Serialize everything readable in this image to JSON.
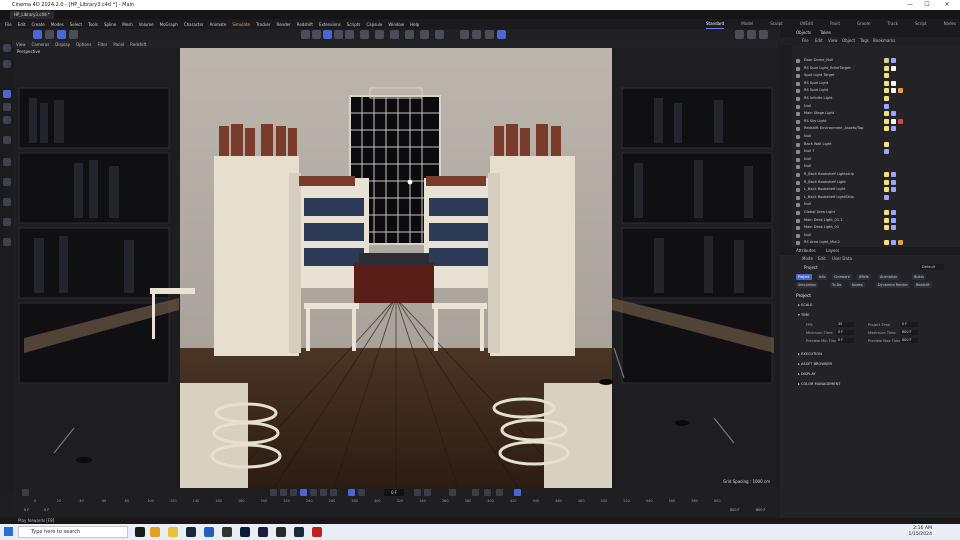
{
  "window": {
    "title": "Cinema 4D 2024.2.0 - [HP_Library3.c4d *] - Main",
    "controls": [
      "—",
      "☐",
      "✕"
    ]
  },
  "doc_tab": "HP_Library3.c4d *",
  "menus": [
    "File",
    "Edit",
    "Create",
    "Modes",
    "Select",
    "Tools",
    "Spline",
    "Mesh",
    "Volume",
    "MoGraph",
    "Character",
    "Animate",
    "Simulate",
    "Tracker",
    "Render",
    "Extensions",
    "Window",
    "Help"
  ],
  "menu_highlight": "Simulate",
  "menus_extra": [
    "Redshift",
    "Scripts",
    "Capsule",
    "Window",
    "Help"
  ],
  "layouts": [
    "Standard",
    "Model",
    "Sculpt",
    "UVEdit",
    "Paint",
    "Groom",
    "Track",
    "Script",
    "Nodes"
  ],
  "active_layout": "Standard",
  "view_menu": [
    "View",
    "Cameras",
    "Display",
    "Options",
    "Filter",
    "Panel",
    "Redshift"
  ],
  "viewport": {
    "label": "Perspective",
    "grid_spacing": "Grid Spacing : 1000 cm"
  },
  "objects_panel": {
    "tabs": [
      "Objects",
      "Takes"
    ],
    "menu": [
      "File",
      "Edit",
      "View",
      "Object",
      "Tags",
      "Bookmarks"
    ],
    "rows": [
      {
        "name": "Door Dome_Null",
        "tags": [
          "#cfcf9a",
          "#9aa6ff"
        ]
      },
      {
        "name": "RS Spot Light_EnterTarget",
        "tags": [
          "#f2e27a",
          "#ffffff",
          "#222222"
        ]
      },
      {
        "name": "Spot Light Target",
        "tags": [
          "#f2e27a"
        ]
      },
      {
        "name": "RS Spot Light",
        "tags": [
          "#f2e27a",
          "#ffffff",
          "#222222"
        ]
      },
      {
        "name": "RS Spot Light",
        "tags": [
          "#f2e27a",
          "#ffffff",
          "#e0a040"
        ]
      },
      {
        "name": "RS Infinite Light",
        "tags": [
          "#f2e27a"
        ]
      },
      {
        "name": "Null",
        "tags": [
          "#9aa6ff"
        ]
      },
      {
        "name": "Main Stage Light",
        "tags": [
          "#f2e27a",
          "#9aa6ff"
        ]
      },
      {
        "name": "RS Sky Light",
        "tags": [
          "#f2e27a",
          "#ffffff",
          "#e04040"
        ]
      },
      {
        "name": "Redshift Environment_Assets/Top",
        "tags": [
          "#f2e27a",
          "#9aa6ff"
        ]
      },
      {
        "name": "Null",
        "tags": []
      },
      {
        "name": "Back Wall Light",
        "tags": [
          "#f2e27a"
        ]
      },
      {
        "name": "Null 7",
        "tags": [
          "#9aa6ff"
        ]
      },
      {
        "name": "Null",
        "tags": []
      },
      {
        "name": "Null",
        "tags": []
      },
      {
        "name": "R_Back Bookshelf Lightstrip",
        "tags": [
          "#f2e27a",
          "#9aa6ff"
        ]
      },
      {
        "name": "R_Back Bookshelf Light",
        "tags": [
          "#f2e27a",
          "#9aa6ff"
        ]
      },
      {
        "name": "L_Back Bookshelf Light",
        "tags": [
          "#f2e27a",
          "#9aa6ff"
        ]
      },
      {
        "name": "L_Back Bookshelf LightStrip",
        "tags": [
          "#9aa6ff"
        ]
      },
      {
        "name": "Null",
        "tags": []
      },
      {
        "name": "Global Area Light",
        "tags": [
          "#f2e27a",
          "#9aa6ff"
        ]
      },
      {
        "name": "Main Desk Light_01.1",
        "tags": [
          "#f2e27a",
          "#9aa6ff"
        ]
      },
      {
        "name": "Main Desk Light_01",
        "tags": [
          "#f2e27a",
          "#9aa6ff"
        ]
      },
      {
        "name": "Null",
        "tags": []
      },
      {
        "name": "RS Area Light_Mid.2",
        "tags": [
          "#f2e27a",
          "#9aa6ff",
          "#e0a040"
        ]
      }
    ]
  },
  "attributes_panel": {
    "tabs": [
      "Attributes",
      "Layers"
    ],
    "menu": [
      "Mode",
      "Edit",
      "User Data"
    ],
    "object": "Project",
    "dropdown": "Default",
    "mode_tabs": [
      "Project",
      "Info",
      "Cineware",
      "XRefs",
      "Animation",
      "Bullet",
      "Simulation",
      "To Do",
      "Nodes",
      "Dynamics Render",
      "Redshift"
    ],
    "title": "Project",
    "sections": [
      "SCALE",
      "TIME"
    ],
    "fields": [
      {
        "label": "FPS",
        "value": "30"
      },
      {
        "label": "Project Time",
        "value": "0 F"
      },
      {
        "label": "Minimum Time",
        "value": "0 F"
      },
      {
        "label": "Maximum Time",
        "value": "600 F"
      },
      {
        "label": "Preview Min Time",
        "value": "0 F"
      },
      {
        "label": "Preview Max Time",
        "value": "600 F"
      }
    ],
    "collapsed": [
      "EXECUTION",
      "ASSET BROWSER",
      "DISPLAY",
      "COLOR MANAGEMENT"
    ]
  },
  "timeline": {
    "ticks": [
      "0",
      "20",
      "40",
      "60",
      "80",
      "100",
      "120",
      "140",
      "160",
      "180",
      "200",
      "220",
      "240",
      "260",
      "280",
      "300",
      "320",
      "340",
      "360",
      "380",
      "400",
      "420",
      "440",
      "460",
      "480",
      "500",
      "520",
      "540",
      "560",
      "580",
      "600"
    ],
    "current_frame": "0 F",
    "start": "0 F",
    "end": "600 F",
    "end2": "600 F",
    "start2": "0 F"
  },
  "status": "Play forwards [F8]",
  "taskbar": {
    "search_placeholder": "Type here to search",
    "time": "2:16 AM",
    "date": "1/15/2024"
  },
  "colors": {
    "accent": "#4b67d6",
    "menu_highlight": "#ff9d3c"
  }
}
